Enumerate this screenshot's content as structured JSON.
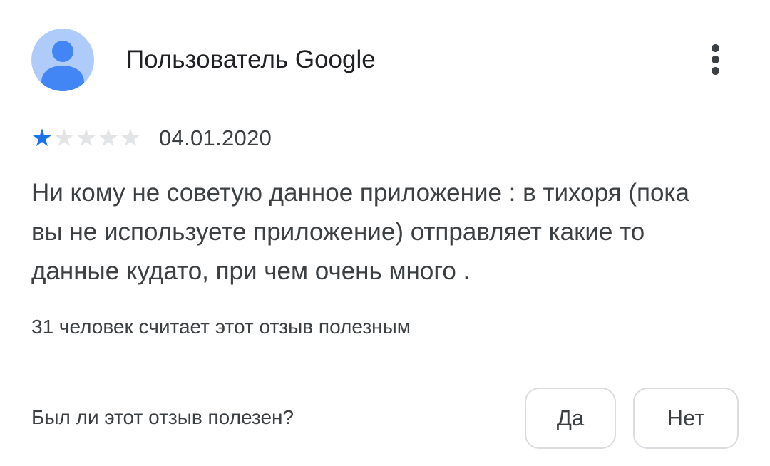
{
  "review": {
    "author": "Пользователь Google",
    "avatar_icon": "person-icon",
    "menu_icon": "more-vert-icon",
    "rating": {
      "value": 1,
      "max": 5,
      "filled_color": "#1a73e8",
      "empty_color": "#e3e4e6"
    },
    "date": "04.01.2020",
    "text": "Ни кому не советую данное приложение : в тихоря (пока вы не используете приложение) отправляет какие то данные кудато, при чем очень много .",
    "helpful_count": "31 человек считает этот отзыв полезным",
    "helpful_question": "Был ли этот отзыв полезен?",
    "yes_label": "Да",
    "no_label": "Нет"
  },
  "colors": {
    "accent": "#1a73e8",
    "avatar_bg": "#aecbfa",
    "avatar_fg": "#4285f4"
  }
}
